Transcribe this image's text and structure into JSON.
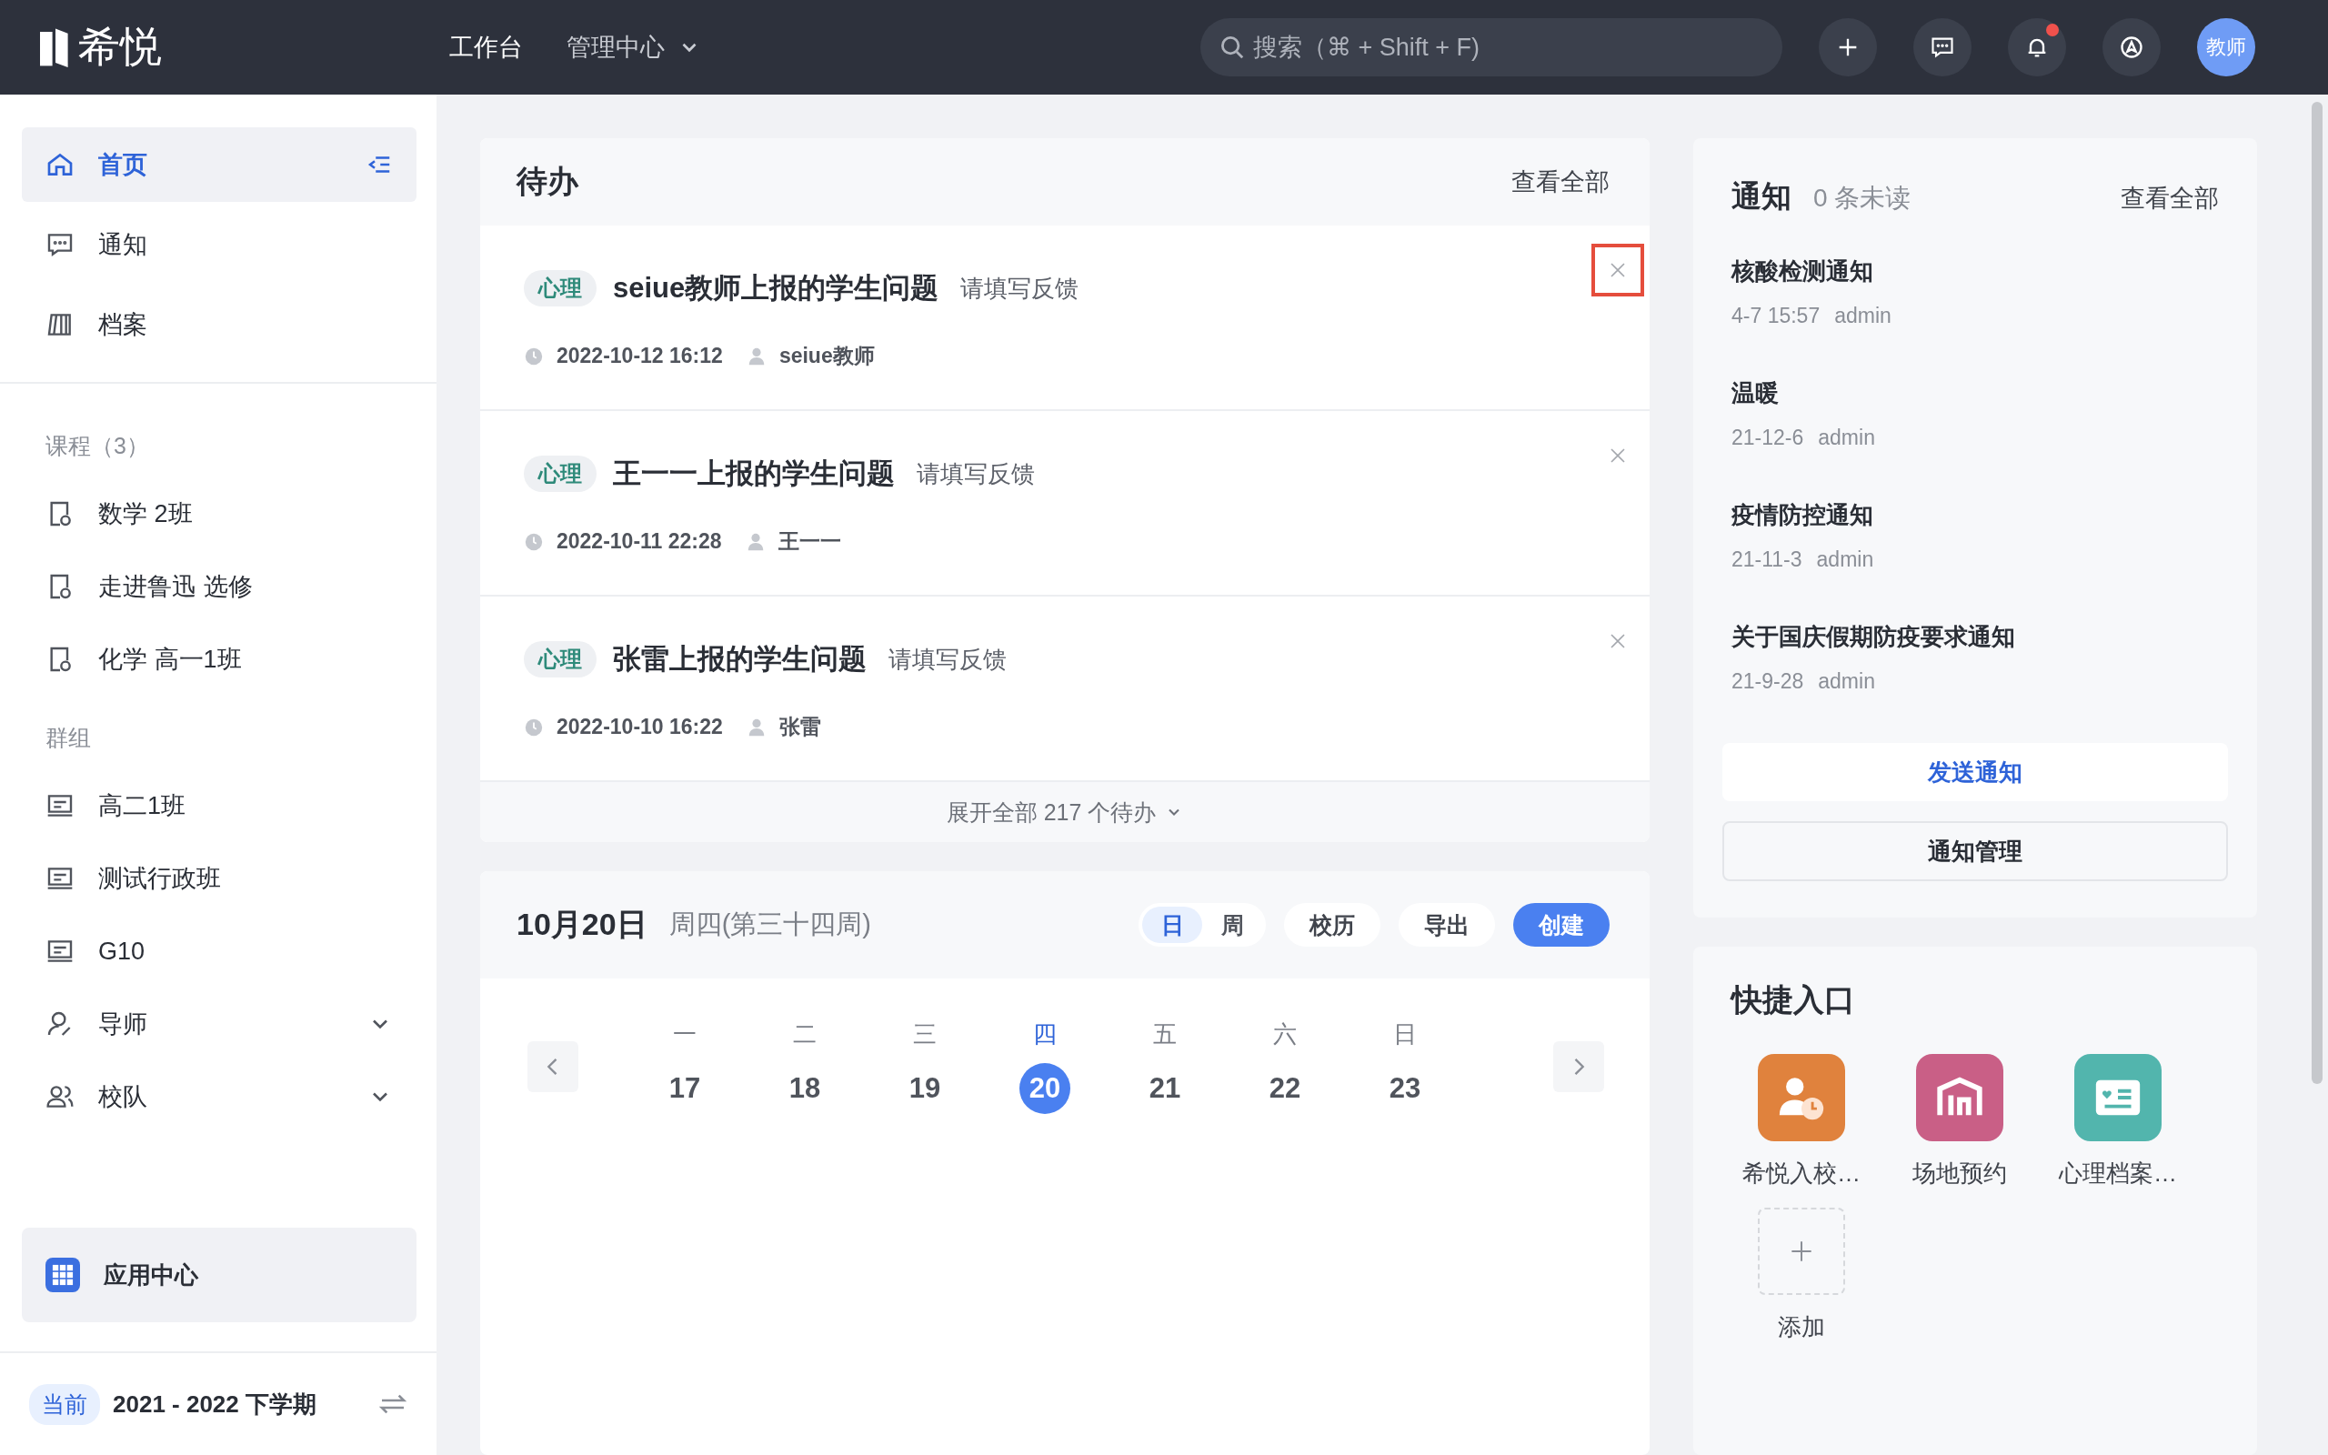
{
  "topbar": {
    "logo_text": "希悦",
    "nav": [
      {
        "label": "工作台",
        "selected": true,
        "dropdown": false
      },
      {
        "label": "管理中心",
        "selected": false,
        "dropdown": true
      }
    ],
    "search": {
      "placeholder": "搜索（⌘ + Shift + F)"
    },
    "actions": [
      {
        "kind": "plus",
        "badge": false
      },
      {
        "kind": "chat",
        "badge": false
      },
      {
        "kind": "bell",
        "badge": true
      },
      {
        "kind": "compass",
        "badge": false
      }
    ],
    "avatar": "教师"
  },
  "sidebar": {
    "top_items": [
      {
        "label": "首页",
        "kind": "home",
        "selected": true
      },
      {
        "label": "通知",
        "kind": "chat",
        "selected": false
      },
      {
        "label": "档案",
        "kind": "books",
        "selected": false
      }
    ],
    "sections": [
      {
        "title": "课程（3）",
        "items": [
          {
            "label": "数学 2班",
            "kind": "course",
            "expandable": false
          },
          {
            "label": "走进鲁迅 选修",
            "kind": "course",
            "expandable": false
          },
          {
            "label": "化学 高一1班",
            "kind": "course",
            "expandable": false
          }
        ]
      },
      {
        "title": "群组",
        "items": [
          {
            "label": "高二1班",
            "kind": "group",
            "expandable": false
          },
          {
            "label": "测试行政班",
            "kind": "group",
            "expandable": false
          },
          {
            "label": "G10",
            "kind": "group",
            "expandable": false
          },
          {
            "label": "导师",
            "kind": "mentor",
            "expandable": true
          },
          {
            "label": "校队",
            "kind": "team",
            "expandable": true
          }
        ]
      }
    ],
    "app_center": "应用中心",
    "term": {
      "badge": "当前",
      "label": "2021 - 2022 下学期"
    }
  },
  "todo": {
    "title": "待办",
    "view_all": "查看全部",
    "items": [
      {
        "tag": "心理",
        "title": "seiue教师上报的学生问题",
        "hint": "请填写反馈",
        "time": "2022-10-12 16:12",
        "person": "seiue教师",
        "highlighted": true
      },
      {
        "tag": "心理",
        "title": "王一一上报的学生问题",
        "hint": "请填写反馈",
        "time": "2022-10-11 22:28",
        "person": "王一一",
        "highlighted": false
      },
      {
        "tag": "心理",
        "title": "张雷上报的学生问题",
        "hint": "请填写反馈",
        "time": "2022-10-10 16:22",
        "person": "张雷",
        "highlighted": false
      }
    ],
    "expand": "展开全部 217 个待办"
  },
  "calendar": {
    "date": "10月20日",
    "subtitle": "周四(第三十四周)",
    "view_toggle": [
      {
        "label": "日",
        "selected": true
      },
      {
        "label": "周",
        "selected": false
      }
    ],
    "buttons": [
      {
        "label": "校历",
        "kind": "plain"
      },
      {
        "label": "导出",
        "kind": "plain"
      },
      {
        "label": "创建",
        "kind": "primary"
      }
    ],
    "days": [
      {
        "weekday": "一",
        "date": "17",
        "selected": false
      },
      {
        "weekday": "二",
        "date": "18",
        "selected": false
      },
      {
        "weekday": "三",
        "date": "19",
        "selected": false
      },
      {
        "weekday": "四",
        "date": "20",
        "selected": true
      },
      {
        "weekday": "五",
        "date": "21",
        "selected": false
      },
      {
        "weekday": "六",
        "date": "22",
        "selected": false
      },
      {
        "weekday": "日",
        "date": "23",
        "selected": false
      }
    ]
  },
  "notices": {
    "title": "通知",
    "unread": "0 条未读",
    "view_all": "查看全部",
    "items": [
      {
        "title": "核酸检测通知",
        "time": "4-7 15:57",
        "author": "admin"
      },
      {
        "title": "温暖",
        "time": "21-12-6",
        "author": "admin"
      },
      {
        "title": "疫情防控通知",
        "time": "21-11-3",
        "author": "admin"
      },
      {
        "title": "关于国庆假期防疫要求通知",
        "time": "21-9-28",
        "author": "admin"
      }
    ],
    "send": "发送通知",
    "manage": "通知管理"
  },
  "quick": {
    "title": "快捷入口",
    "apps": [
      {
        "label": "希悦入校…",
        "color": "#e0823d",
        "kind": "person-clock"
      },
      {
        "label": "场地预约",
        "color": "#c95f86",
        "kind": "building"
      },
      {
        "label": "心理档案…",
        "color": "#52b5ad",
        "kind": "card"
      }
    ],
    "add": "添加"
  }
}
